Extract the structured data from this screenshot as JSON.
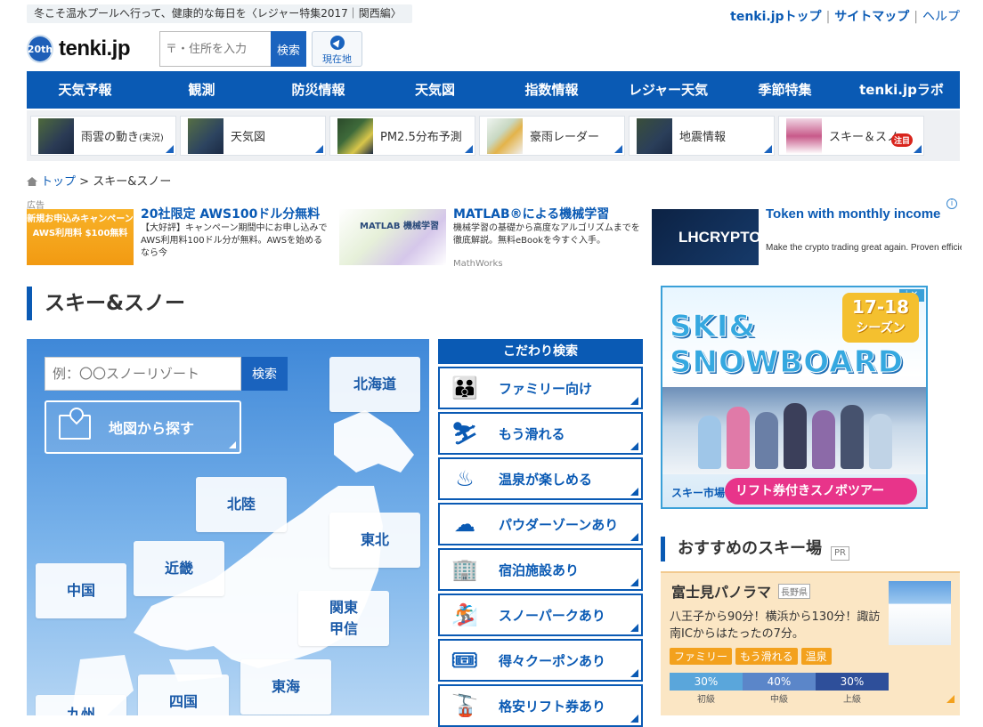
{
  "notice": "冬こそ温水プールへ行って、健康的な毎日を〈レジャー特集2017｜関西編〉",
  "toplinks": {
    "top": "tenki.jpトップ",
    "sitemap": "サイトマップ",
    "help": "ヘルプ"
  },
  "logo": {
    "badge": "20th",
    "text": "tenki.jp"
  },
  "search": {
    "placeholder": "〒・住所を入力",
    "button": "検索"
  },
  "location_button": "現在地",
  "gnav": [
    "天気予報",
    "観測",
    "防災情報",
    "天気図",
    "指数情報",
    "レジャー天気",
    "季節特集",
    "tenki.jpラボ"
  ],
  "subnav": [
    {
      "label": "雨雲の動き",
      "suffix": "(実況)"
    },
    {
      "label": "天気図"
    },
    {
      "label": "PM2.5分布予測"
    },
    {
      "label": "豪雨レーダー"
    },
    {
      "label": "地震情報"
    },
    {
      "label": "スキー＆スノー",
      "badge": "注目"
    }
  ],
  "breadcrumb": {
    "home": "トップ",
    "sep": ">",
    "current": "スキー&スノー"
  },
  "ads": {
    "label": "広告",
    "items": [
      {
        "img_text": "新規お申込みキャンペーン AWS利用料 $100無料",
        "title": "20社限定 AWS100ドル分無料",
        "desc": "【大好評】キャンペーン期間中にお申し込みでAWS利用料100ドル分が無料。AWSを始めるなら今"
      },
      {
        "img_text": "MATLAB 機械学習",
        "title": "MATLAB®による機械学習",
        "desc": "機械学習の基礎から高度なアルゴリズムまでを徹底解説。無料eBookを今すぐ入手。",
        "sponsor": "MathWorks"
      },
      {
        "img_text": "LHCRYPTO",
        "title": "Token with monthly income",
        "desc": "Make the crypto trading great again. Proven efficiency based on a real financial"
      }
    ]
  },
  "page_title": "スキー&スノー",
  "map": {
    "search_placeholder": "例：〇〇スノーリゾート",
    "search_button": "検索",
    "find_button": "地図から探す",
    "regions": {
      "hokkaido": "北海道",
      "hokuriku": "北陸",
      "tohoku": "東北",
      "kinki": "近畿",
      "chugoku": "中国",
      "kanto1": "関東",
      "kanto2": "甲信",
      "tokai": "東海",
      "shikoku": "四国",
      "kyushu": "九州"
    }
  },
  "kodawari": {
    "header": "こだわり検索",
    "items": [
      {
        "label": "ファミリー向け",
        "icon": "family-icon"
      },
      {
        "label": "もう滑れる",
        "icon": "skier-icon"
      },
      {
        "label": "温泉が楽しめる",
        "icon": "hot-spring-icon"
      },
      {
        "label": "パウダーゾーンあり",
        "icon": "snow-cloud-icon"
      },
      {
        "label": "宿泊施設あり",
        "icon": "building-icon"
      },
      {
        "label": "スノーパークあり",
        "icon": "snowboarder-icon"
      },
      {
        "label": "得々クーポンあり",
        "icon": "ticket-icon"
      },
      {
        "label": "格安リフト券あり",
        "icon": "lift-icon"
      }
    ]
  },
  "banner": {
    "title1": "SKI&",
    "title2": "SNOWBOARD",
    "season1": "17-18",
    "season2": "シーズン",
    "brand": "スキー市場",
    "tour": "リフト券付きスノボツアー"
  },
  "recommend": {
    "title": "おすすめのスキー場",
    "pr": "PR",
    "name": "富士見パノラマ",
    "pref": "長野県",
    "desc": "八王子から90分！横浜から130分！諏訪南ICからはたったの7分。",
    "tags": [
      "ファミリー",
      "もう滑れる",
      "温泉"
    ],
    "levels": [
      {
        "pct": "30%",
        "name": "初級",
        "value": 30,
        "color": "#5aa6db"
      },
      {
        "pct": "40%",
        "name": "中級",
        "value": 40,
        "color": "#5b86c9"
      },
      {
        "pct": "30%",
        "name": "上級",
        "value": 30,
        "color": "#2e4f9a"
      }
    ]
  },
  "colors": {
    "primary": "#0a5ab4",
    "accent": "#f3a11d",
    "hot": "#d9241c"
  }
}
